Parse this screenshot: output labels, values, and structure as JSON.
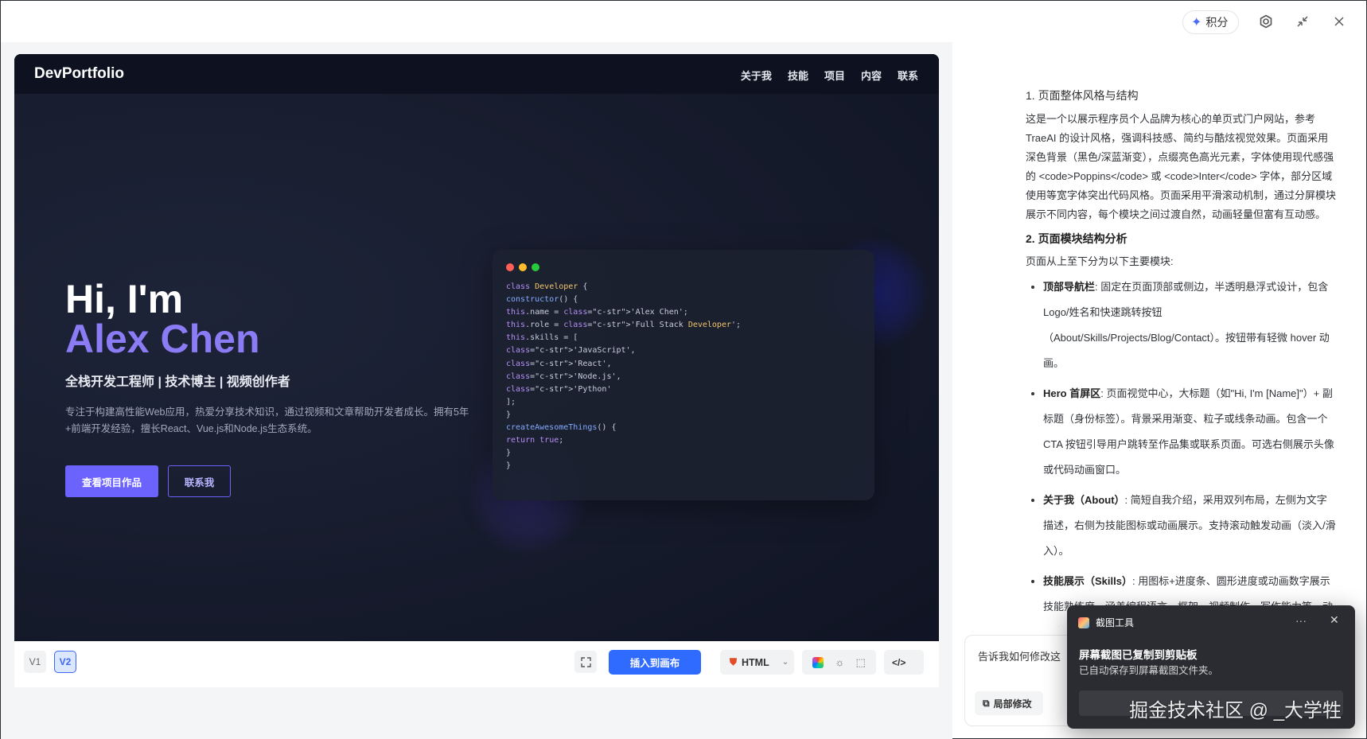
{
  "topbar": {
    "points_label": "积分"
  },
  "site": {
    "logo": "DevPortfolio",
    "nav": [
      "关于我",
      "技能",
      "项目",
      "内容",
      "联系"
    ],
    "hero_hi": "Hi, I'm",
    "hero_name": "Alex Chen",
    "hero_sub": "全栈开发工程师 | 技术博主 | 视频创作者",
    "hero_desc": "专注于构建高性能Web应用，热爱分享技术知识，通过视频和文章帮助开发者成长。拥有5年+前端开发经验，擅长React、Vue.js和Node.js生态系统。",
    "btn_primary": "查看项目作品",
    "btn_secondary": "联系我",
    "dot_colors": [
      "#ff5f56",
      "#ffbd2e",
      "#27c93f"
    ],
    "code_lines": [
      "class Developer {",
      "constructor() {",
      "this.name = 'Alex Chen';",
      "this.role = 'Full Stack Developer';",
      "this.skills = [",
      "'JavaScript',",
      "'React',",
      "'Node.js',",
      "'Python'",
      "];",
      "}",
      "createAwesomeThings() {",
      "return true;",
      "}",
      "}"
    ]
  },
  "toolbar": {
    "versions": [
      "V1",
      "V2"
    ],
    "insert_label": "插入到画布",
    "format_label": "HTML",
    "code_label": "</>"
  },
  "doc": {
    "h1": "1. 页面整体风格与结构",
    "p1": "这是一个以展示程序员个人品牌为核心的单页式门户网站，参考 TraeAI 的设计风格，强调科技感、简约与酷炫视觉效果。页面采用深色背景（黑色/深蓝渐变），点缀亮色高光元素，字体使用现代感强的 <code>Poppins</code> 或 <code>Inter</code> 字体，部分区域使用等宽字体突出代码风格。页面采用平滑滚动机制，通过分屏模块展示不同内容，每个模块之间过渡自然，动画轻量但富有互动感。",
    "h2": "2. 页面模块结构分析",
    "p2": "页面从上至下分为以下主要模块:",
    "items": [
      {
        "title": "顶部导航栏",
        "text": ": 固定在页面顶部或侧边，半透明悬浮式设计，包含Logo/姓名和快速跳转按钮（About/Skills/Projects/Blog/Contact）。按钮带有轻微 hover 动画。"
      },
      {
        "title": "Hero 首屏区",
        "text": ": 页面视觉中心，大标题（如\"Hi, I'm [Name]\"）+ 副标题（身份标签）。背景采用渐变、粒子或线条动画。包含一个 CTA 按钮引导用户跳转至作品集或联系页面。可选右侧展示头像或代码动画窗口。"
      },
      {
        "title": "关于我（About）",
        "text": ": 简短自我介绍，采用双列布局，左侧为文字描述，右侧为技能图标或动画展示。支持滚动触发动画（淡入/滑入）。"
      },
      {
        "title": "技能展示（Skills）",
        "text": ": 用图标+进度条、圆形进度或动画数字展示技能熟练度，涵盖编程语言、框架、视频制作、写作能力等，动画由滚动触发。"
      }
    ]
  },
  "chat": {
    "placeholder": "告诉我如何修改这",
    "local_edit": "局部修改"
  },
  "toast": {
    "app_name": "截图工具",
    "title": "屏幕截图已复制到剪贴板",
    "body": "已自动保存到屏幕截图文件夹。",
    "more": "···",
    "close": "✕"
  },
  "watermark": "掘金技术社区 @ _大学牲"
}
